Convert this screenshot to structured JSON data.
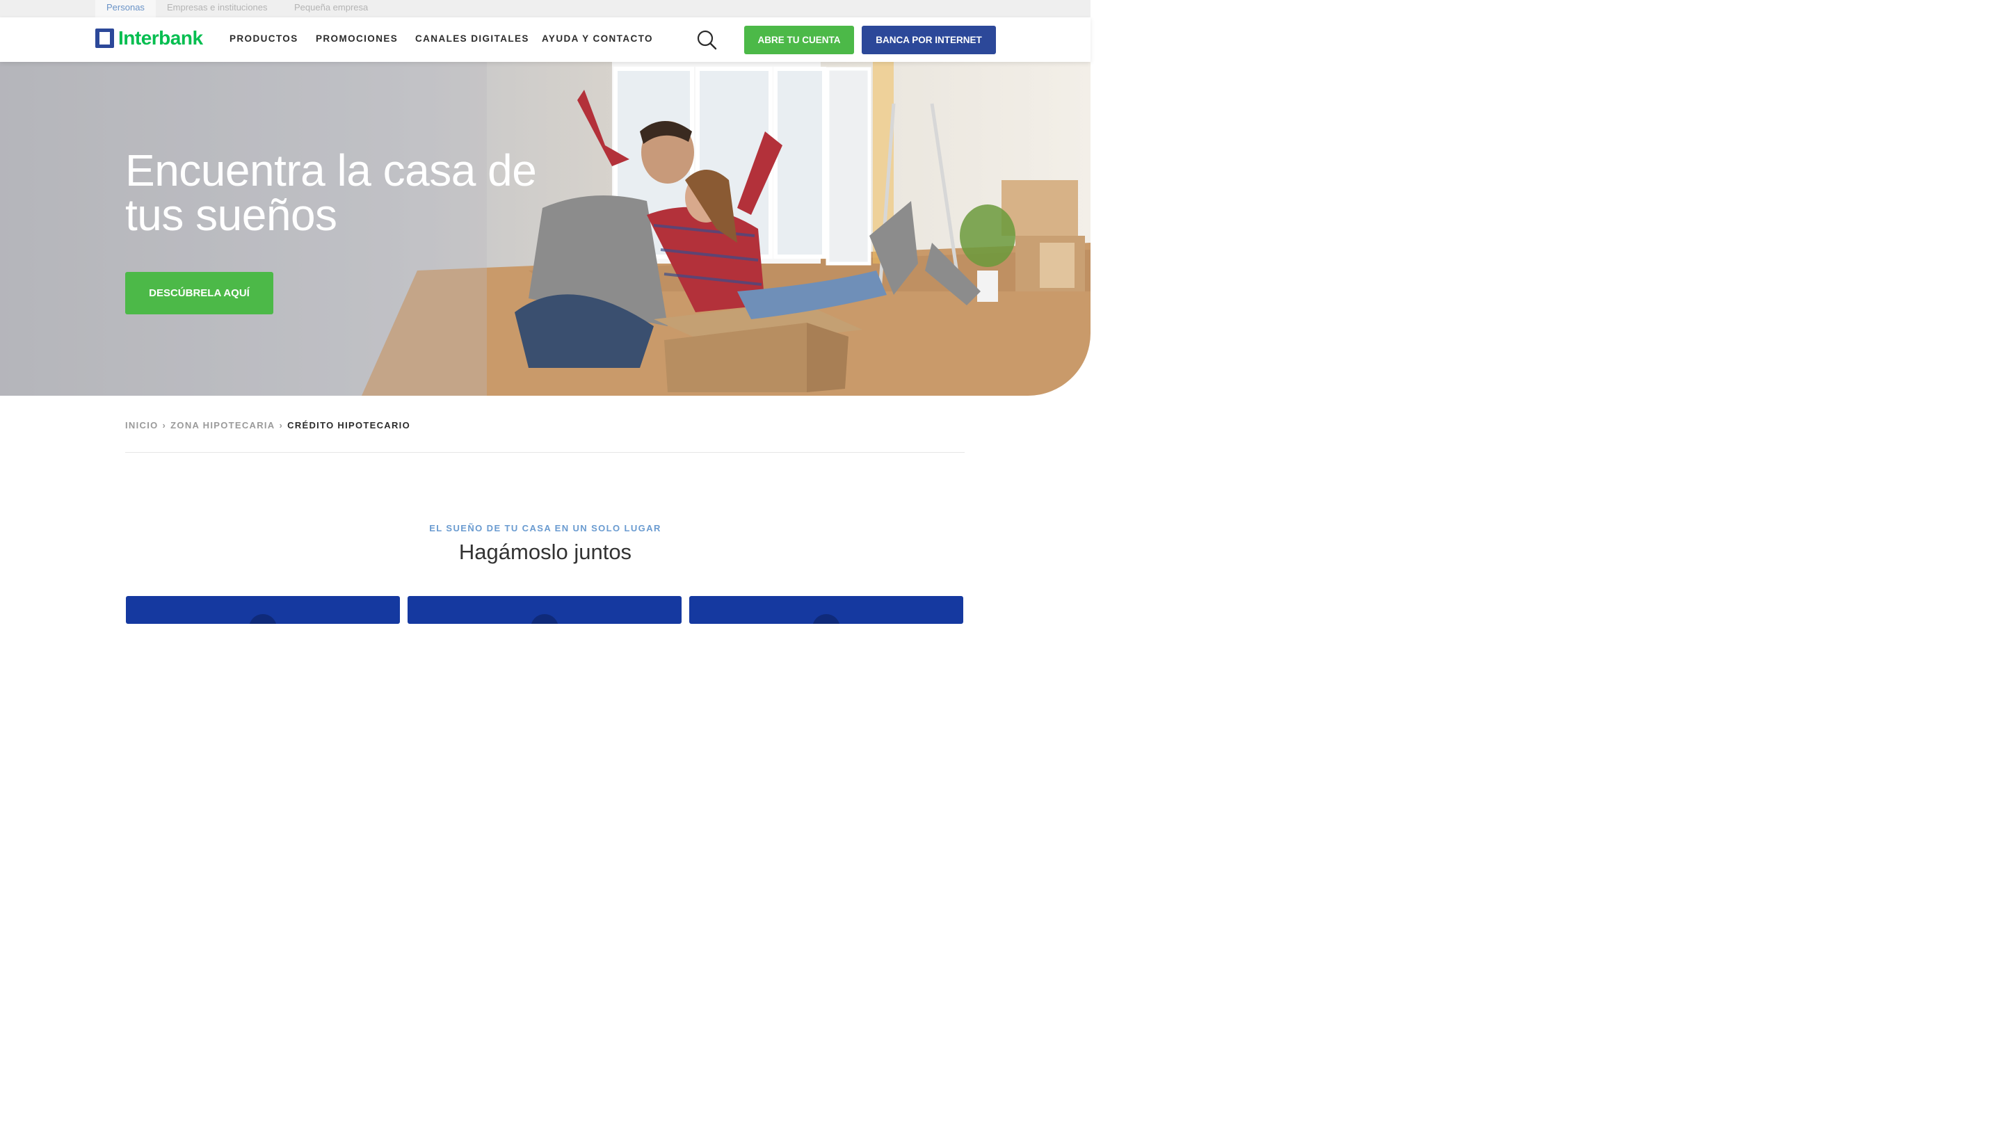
{
  "segments": [
    "Personas",
    "Empresas e instituciones",
    "Pequeña empresa"
  ],
  "header": {
    "logo_text": "Interbank",
    "nav": [
      "PRODUCTOS",
      "PROMOCIONES",
      "CANALES DIGITALES",
      "AYUDA Y CONTACTO"
    ],
    "open_account": "ABRE TU CUENTA",
    "online_banking": "BANCA POR INTERNET"
  },
  "hero": {
    "title": "Encuentra la casa de tus sueños",
    "cta": "DESCÚBRELA AQUÍ"
  },
  "breadcrumb": {
    "items": [
      "INICIO",
      "ZONA HIPOTECARIA"
    ],
    "current": "CRÉDITO HIPOTECARIO"
  },
  "section": {
    "eyebrow": "EL SUEÑO DE TU CASA EN UN SOLO LUGAR",
    "title": "Hagámoslo juntos"
  },
  "colors": {
    "brand_green": "#4cb948",
    "brand_blue": "#2c4899",
    "logo_green": "#05be50",
    "card_blue": "#1539a0",
    "eyebrow_blue": "#6a9bd0"
  }
}
